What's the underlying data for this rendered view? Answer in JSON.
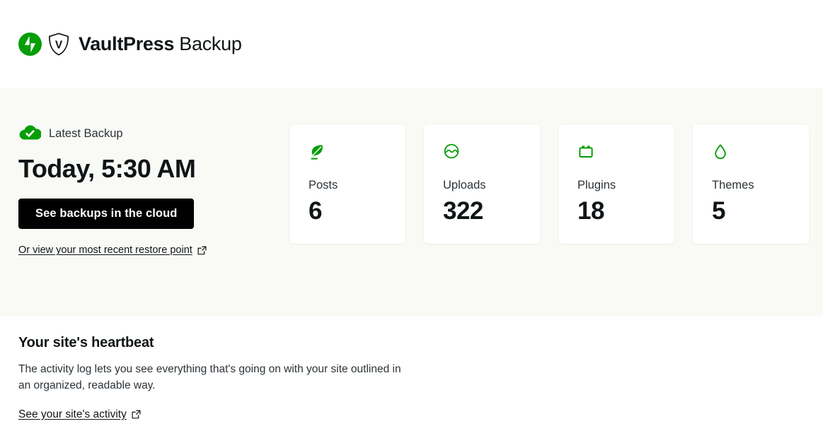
{
  "header": {
    "logo": {
      "jetpack_icon": "jetpack-logo-icon",
      "shield_icon": "vaultpress-shield-icon",
      "product_strong": "VaultPress",
      "product_light": "Backup"
    }
  },
  "hero": {
    "status_icon": "cloud-check-icon",
    "status_label": "Latest Backup",
    "title": "Today, 5:30 AM",
    "cta_label": "See backups in the cloud",
    "restore_link_label": "Or view your most recent restore point",
    "restore_link_icon": "external-link-icon",
    "background_color": "#f9faf6",
    "accent_color": "#069e08"
  },
  "stats": [
    {
      "icon": "leaf-quill-icon",
      "label": "Posts",
      "value": "6"
    },
    {
      "icon": "media-circle-icon",
      "label": "Uploads",
      "value": "322"
    },
    {
      "icon": "plug-icon",
      "label": "Plugins",
      "value": "18"
    },
    {
      "icon": "droplet-icon",
      "label": "Themes",
      "value": "5"
    }
  ],
  "heartbeat": {
    "title": "Your site's heartbeat",
    "body": "The activity log lets you see everything that's going on with your site outlined in an organized, readable way.",
    "link_label": "See your site's activity",
    "link_icon": "external-link-icon"
  }
}
